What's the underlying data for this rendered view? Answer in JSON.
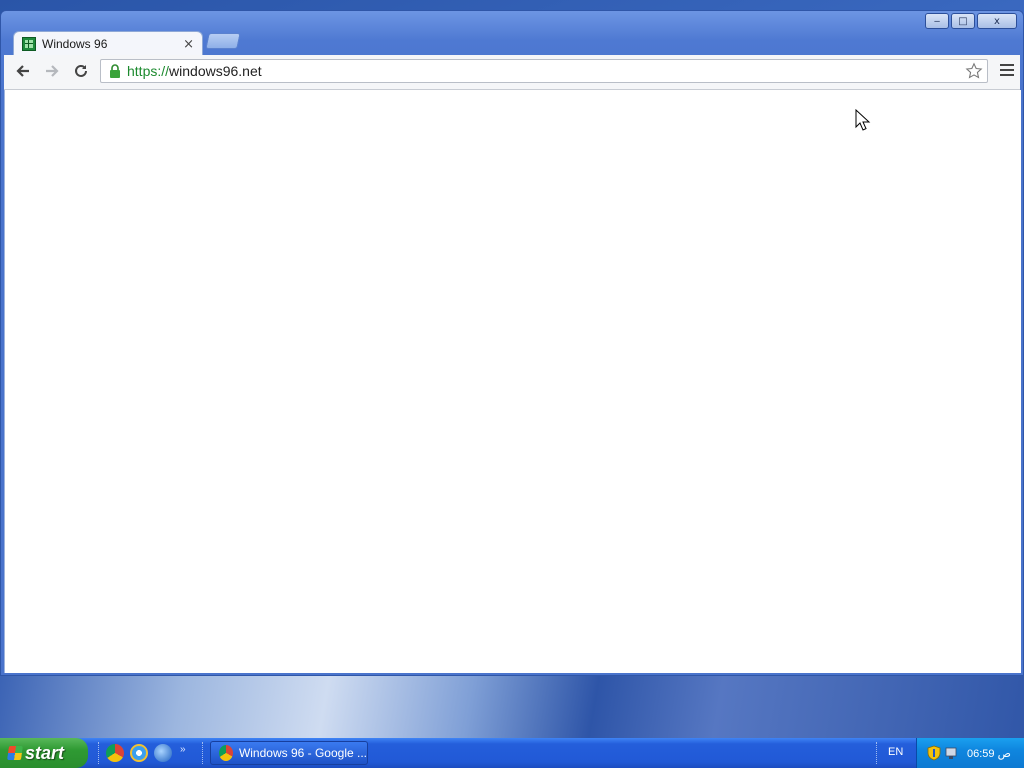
{
  "browser": {
    "tab": {
      "title": "Windows 96",
      "close_glyph": "×",
      "favicon": "windows96-favicon"
    },
    "address": {
      "scheme": "https://",
      "host": "windows96.net"
    },
    "window_controls": {
      "minimize": "‒",
      "maximize": "□",
      "close": "x"
    }
  },
  "taskbar": {
    "start_label": "start",
    "quick_launch": [
      "chrome-icon",
      "internet-explorer-icon",
      "globe-icon"
    ],
    "quick_launch_more": "»",
    "active_task": {
      "label": "Windows 96 - Google ...",
      "icon": "chrome-icon"
    },
    "language": "EN",
    "clock": "06:59 ص"
  },
  "colors": {
    "accent": "#245edb",
    "start_green": "#2f9a33",
    "secure_green": "#1c8a2e"
  }
}
